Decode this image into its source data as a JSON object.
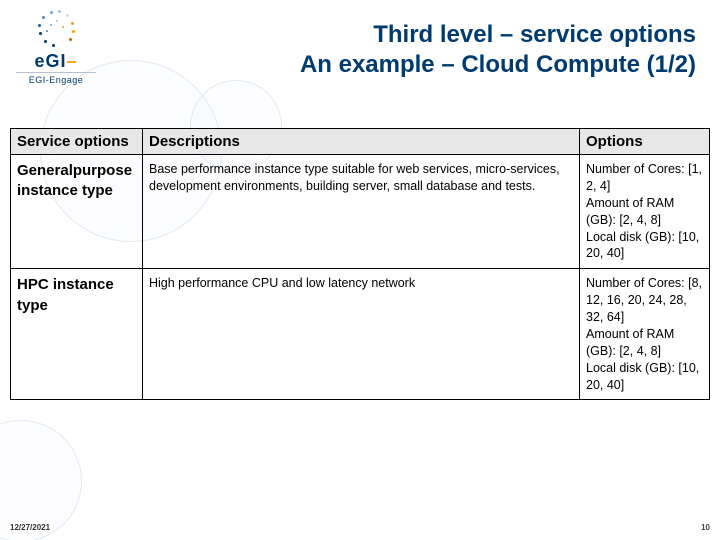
{
  "logo": {
    "line1": "eGI",
    "sub": "EGI-Engage"
  },
  "title": {
    "line1": "Third level – service options",
    "line2": "An example – Cloud Compute (1/2)"
  },
  "table": {
    "headers": {
      "col1": "Service options",
      "col2": "Descriptions",
      "col3": "Options"
    },
    "rows": [
      {
        "name": "Generalpurpose instance type",
        "desc": "Base performance instance type suitable for web services, micro-services, development environments, building server, small database and tests.",
        "opts": "Number of Cores: [1, 2, 4]\nAmount of RAM (GB): [2, 4, 8]\nLocal disk (GB): [10, 20, 40]"
      },
      {
        "name": "HPC instance type",
        "desc": "High performance CPU and low latency network",
        "opts": "Number of Cores: [8, 12, 16, 20, 24, 28, 32, 64]\nAmount of RAM (GB): [2, 4, 8]\nLocal disk (GB): [10, 20, 40]"
      }
    ]
  },
  "footer": {
    "date": "12/27/2021",
    "page": "10"
  }
}
